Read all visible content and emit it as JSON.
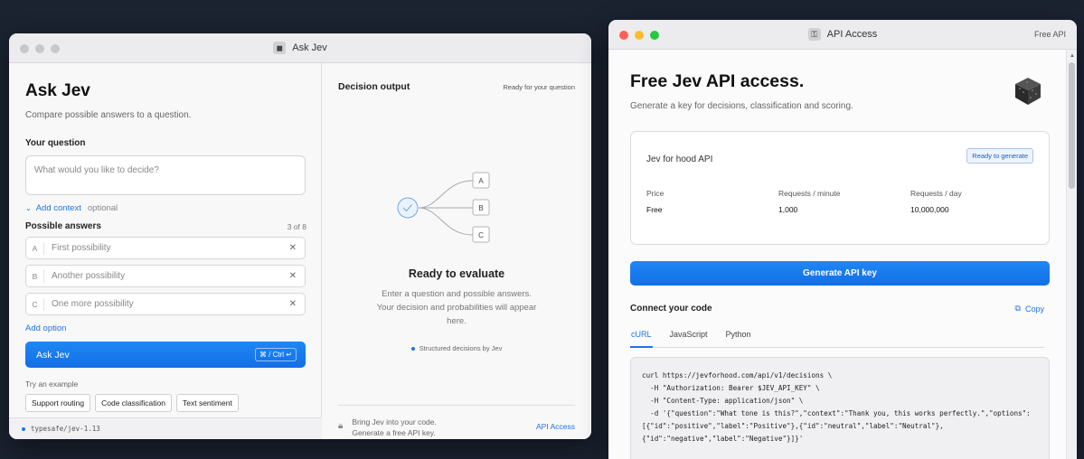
{
  "colors": {
    "accent": "#1f74e0",
    "red": "#ff5f57",
    "yellow": "#febc2e",
    "green": "#28c840",
    "gray_light": "#c8c8cc"
  },
  "left": {
    "title": "Ask Jev",
    "heading": "Ask Jev",
    "subtitle": "Compare possible answers to a question.",
    "question_label": "Your question",
    "question_placeholder": "What would you like to decide?",
    "add_context": "Add context",
    "optional": "optional",
    "answers_label": "Possible answers",
    "answers_count": "3 of 8",
    "answers": [
      {
        "letter": "A",
        "placeholder": "First possibility"
      },
      {
        "letter": "B",
        "placeholder": "Another possibility"
      },
      {
        "letter": "C",
        "placeholder": "One more possibility"
      }
    ],
    "add_option": "Add option",
    "ask_button": "Ask Jev",
    "shortcut": "⌘ / Ctrl ↵",
    "try_label": "Try an example",
    "examples": [
      "Support routing",
      "Code classification",
      "Text sentiment"
    ],
    "footer": "typesafe/jev-1.13",
    "output_title": "Decision output",
    "output_status": "Ready for your question",
    "diagram_options": [
      "A",
      "B",
      "C"
    ],
    "ready_title": "Ready to evaluate",
    "ready_sub": "Enter a question and possible answers. Your decision and probabilities will appear here.",
    "structured": "Structured decisions by Jev",
    "bring_line1": "Bring Jev into your code.",
    "bring_line2": "Generate a free API key.",
    "api_link": "API Access"
  },
  "right": {
    "title": "API Access",
    "title_right": "Free API",
    "heading": "Free Jev API access.",
    "subtitle": "Generate a key for decisions, classification and scoring.",
    "card_title": "Jev for hood API",
    "card_badge": "Ready to generate",
    "price_label": "Price",
    "price_value": "Free",
    "rpm_label": "Requests / minute",
    "rpm_value": "1,000",
    "rpd_label": "Requests / day",
    "rpd_value": "10,000,000",
    "generate_button": "Generate API key",
    "connect_title": "Connect your code",
    "copy_label": "Copy",
    "tabs": [
      "cURL",
      "JavaScript",
      "Python"
    ],
    "code": "curl https://jevforhood.com/api/v1/decisions \\\n  -H \"Authorization: Bearer $JEV_API_KEY\" \\\n  -H \"Content-Type: application/json\" \\\n  -d '{\"question\":\"What tone is this?\",\"context\":\"Thank you, this works perfectly.\",\"options\":\n[{\"id\":\"positive\",\"label\":\"Positive\"},{\"id\":\"neutral\",\"label\":\"Neutral\"},\n{\"id\":\"negative\",\"label\":\"Negative\"}]}'"
  }
}
